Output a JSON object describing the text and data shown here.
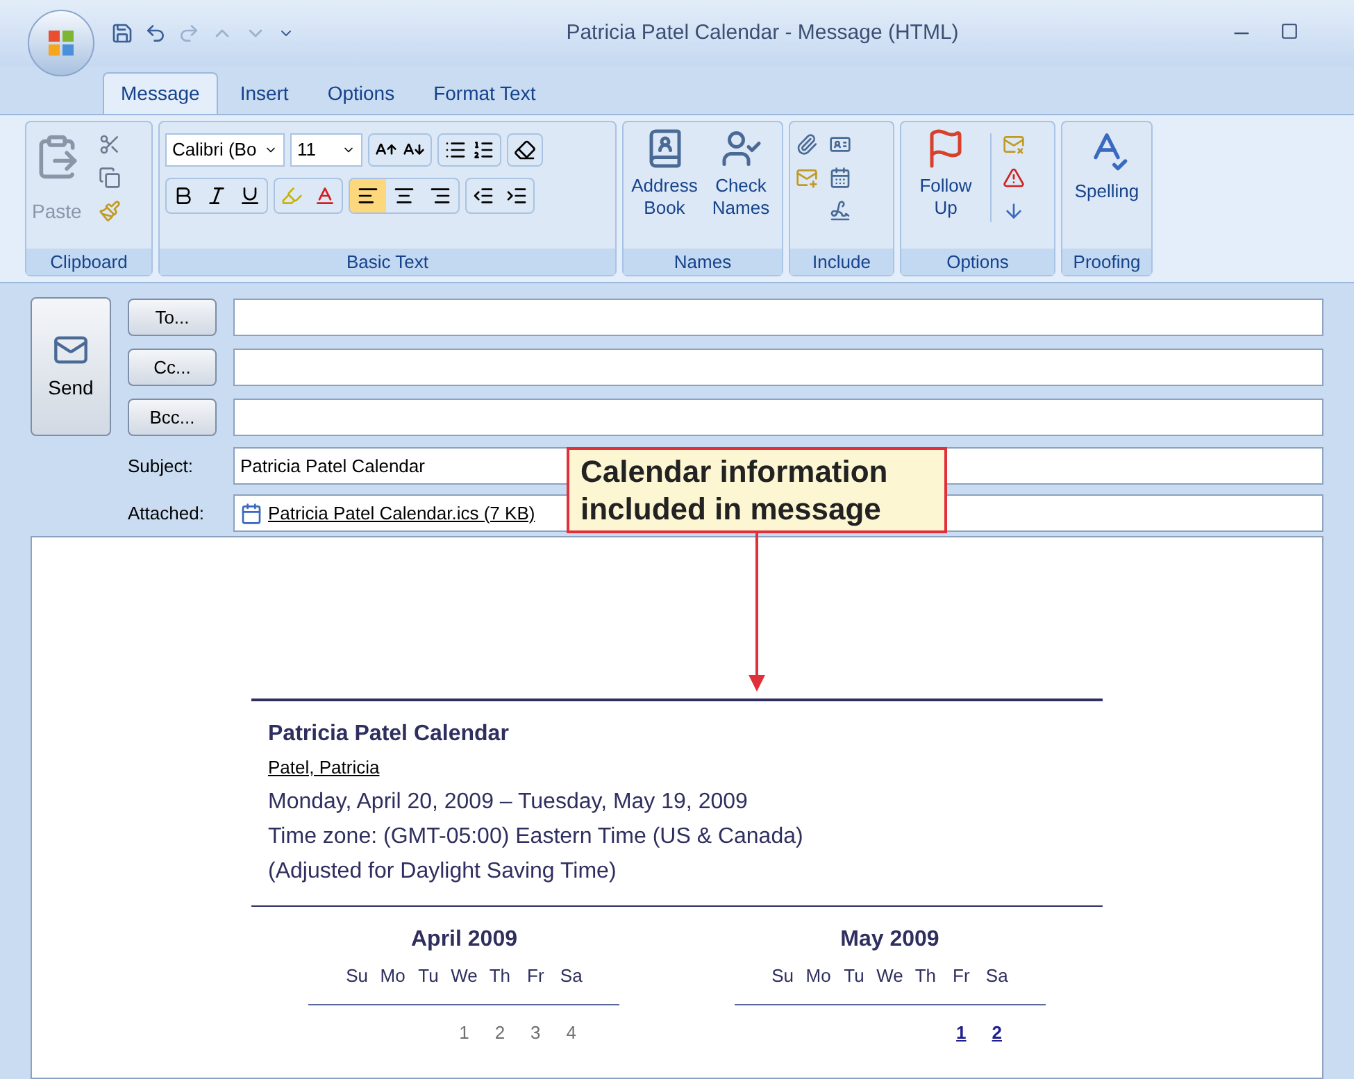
{
  "window": {
    "title": "Patricia Patel Calendar - Message (HTML)"
  },
  "tabs": [
    {
      "label": "Message",
      "selected": true
    },
    {
      "label": "Insert",
      "selected": false
    },
    {
      "label": "Options",
      "selected": false
    },
    {
      "label": "Format Text",
      "selected": false
    }
  ],
  "ribbon": {
    "clipboard": {
      "label": "Clipboard",
      "paste": "Paste"
    },
    "basic_text": {
      "label": "Basic Text",
      "font": "Calibri (Bo",
      "size": "11",
      "alignment": [
        {
          "kind": "left",
          "selected": true
        },
        {
          "kind": "center",
          "selected": false
        },
        {
          "kind": "right",
          "selected": false
        }
      ]
    },
    "names": {
      "label": "Names",
      "buttons": [
        {
          "kind": "address",
          "label": "Address Book"
        },
        {
          "kind": "check",
          "label": "Check Names"
        }
      ]
    },
    "include": {
      "label": "Include"
    },
    "options": {
      "label": "Options",
      "follow_up": "Follow Up"
    },
    "proofing": {
      "label": "Proofing",
      "spelling": "Spelling"
    }
  },
  "header": {
    "send": "Send",
    "fields": [
      {
        "kind": "button",
        "label": "To..."
      },
      {
        "kind": "button",
        "label": "Cc..."
      },
      {
        "kind": "button",
        "label": "Bcc..."
      },
      {
        "kind": "text",
        "label": "Subject:",
        "value": "Patricia Patel Calendar"
      },
      {
        "kind": "attachment",
        "label": "Attached:",
        "value": "Patricia Patel Calendar.ics (7 KB)"
      }
    ]
  },
  "callout": "Calendar information included in message",
  "calendar": {
    "title": "Patricia Patel Calendar",
    "owner": "Patel, Patricia",
    "lines": [
      "Monday, April 20, 2009 – Tuesday, May 19, 2009",
      "Time zone: (GMT-05:00) Eastern Time (US & Canada)",
      "(Adjusted for Daylight Saving Time)"
    ],
    "months": [
      {
        "title": "April 2009",
        "weekdays": [
          "Su",
          "Mo",
          "Tu",
          "We",
          "Th",
          "Fr",
          "Sa"
        ],
        "days": [
          {
            "kind": "blank"
          },
          {
            "kind": "blank"
          },
          {
            "kind": "blank"
          },
          {
            "kind": "day",
            "day": "1",
            "busy": false
          },
          {
            "kind": "day",
            "day": "2",
            "busy": false
          },
          {
            "kind": "day",
            "day": "3",
            "busy": false
          },
          {
            "kind": "day",
            "day": "4",
            "busy": false
          }
        ]
      },
      {
        "title": "May 2009",
        "weekdays": [
          "Su",
          "Mo",
          "Tu",
          "We",
          "Th",
          "Fr",
          "Sa"
        ],
        "days": [
          {
            "kind": "blank"
          },
          {
            "kind": "blank"
          },
          {
            "kind": "blank"
          },
          {
            "kind": "blank"
          },
          {
            "kind": "blank"
          },
          {
            "kind": "day",
            "day": "1",
            "busy": true
          },
          {
            "kind": "day",
            "day": "2",
            "busy": true
          }
        ]
      }
    ]
  }
}
